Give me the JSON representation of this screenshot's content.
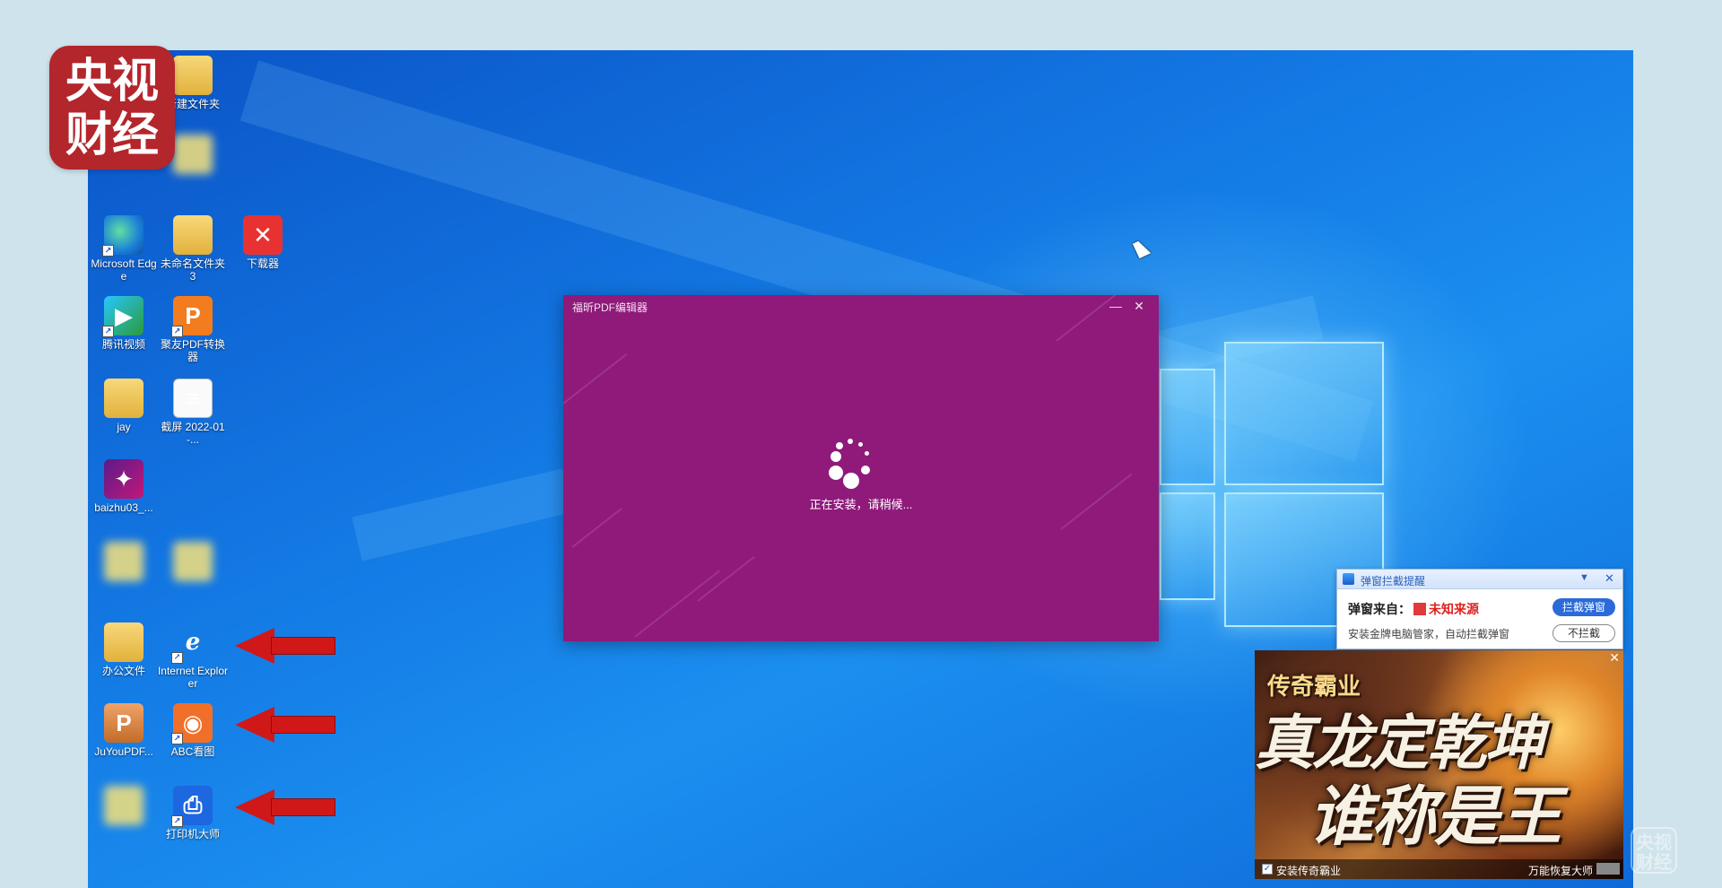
{
  "brand": {
    "line1": "央视",
    "line2": "财经"
  },
  "watermark": {
    "line1": "央视",
    "line2": "财经"
  },
  "desktop_icons": {
    "unnamed_folder_top": "新建文件夹",
    "blurred_top": "",
    "edge": "Microsoft Edge",
    "unnamed_folder_3": "未命名文件夹 3",
    "downloader": "下载器",
    "tencent_video": "腾讯视频",
    "juyou_pdf_converter": "聚友PDF转换器",
    "jay": "jay",
    "screenshot": "截屏 2022-01-...",
    "baizhu": "baizhu03_...",
    "office_files": "办公文件",
    "internet_explorer": "Internet Explorer",
    "juyoupdf": "JuYouPDF...",
    "abc_viewer": "ABC看图",
    "print_master": "打印机大师"
  },
  "installer": {
    "title": "福昕PDF编辑器",
    "minimize": "—",
    "close": "✕",
    "status": "正在安装，请稍候..."
  },
  "popup_blocker": {
    "title": "弹窗拦截提醒",
    "menu": "▼",
    "close": "✕",
    "from_label": "弹窗来自：",
    "from_value": "未知来源",
    "note": "安装金牌电脑管家，自动拦截弹窗",
    "block_button": "拦截弹窗",
    "no_block_button": "不拦截"
  },
  "game_ad": {
    "game_title": "传奇霸业",
    "slogan_line1": "真龙定乾坤",
    "slogan_line2": "谁称是王",
    "close": "✕",
    "checkbox_label": "安装传奇霸业",
    "footer_brand": "万能恢复大师"
  },
  "icons": {
    "shortcut_arrow": "arrow-shortcut-icon",
    "annotation_arrow": "red-arrow-icon"
  }
}
